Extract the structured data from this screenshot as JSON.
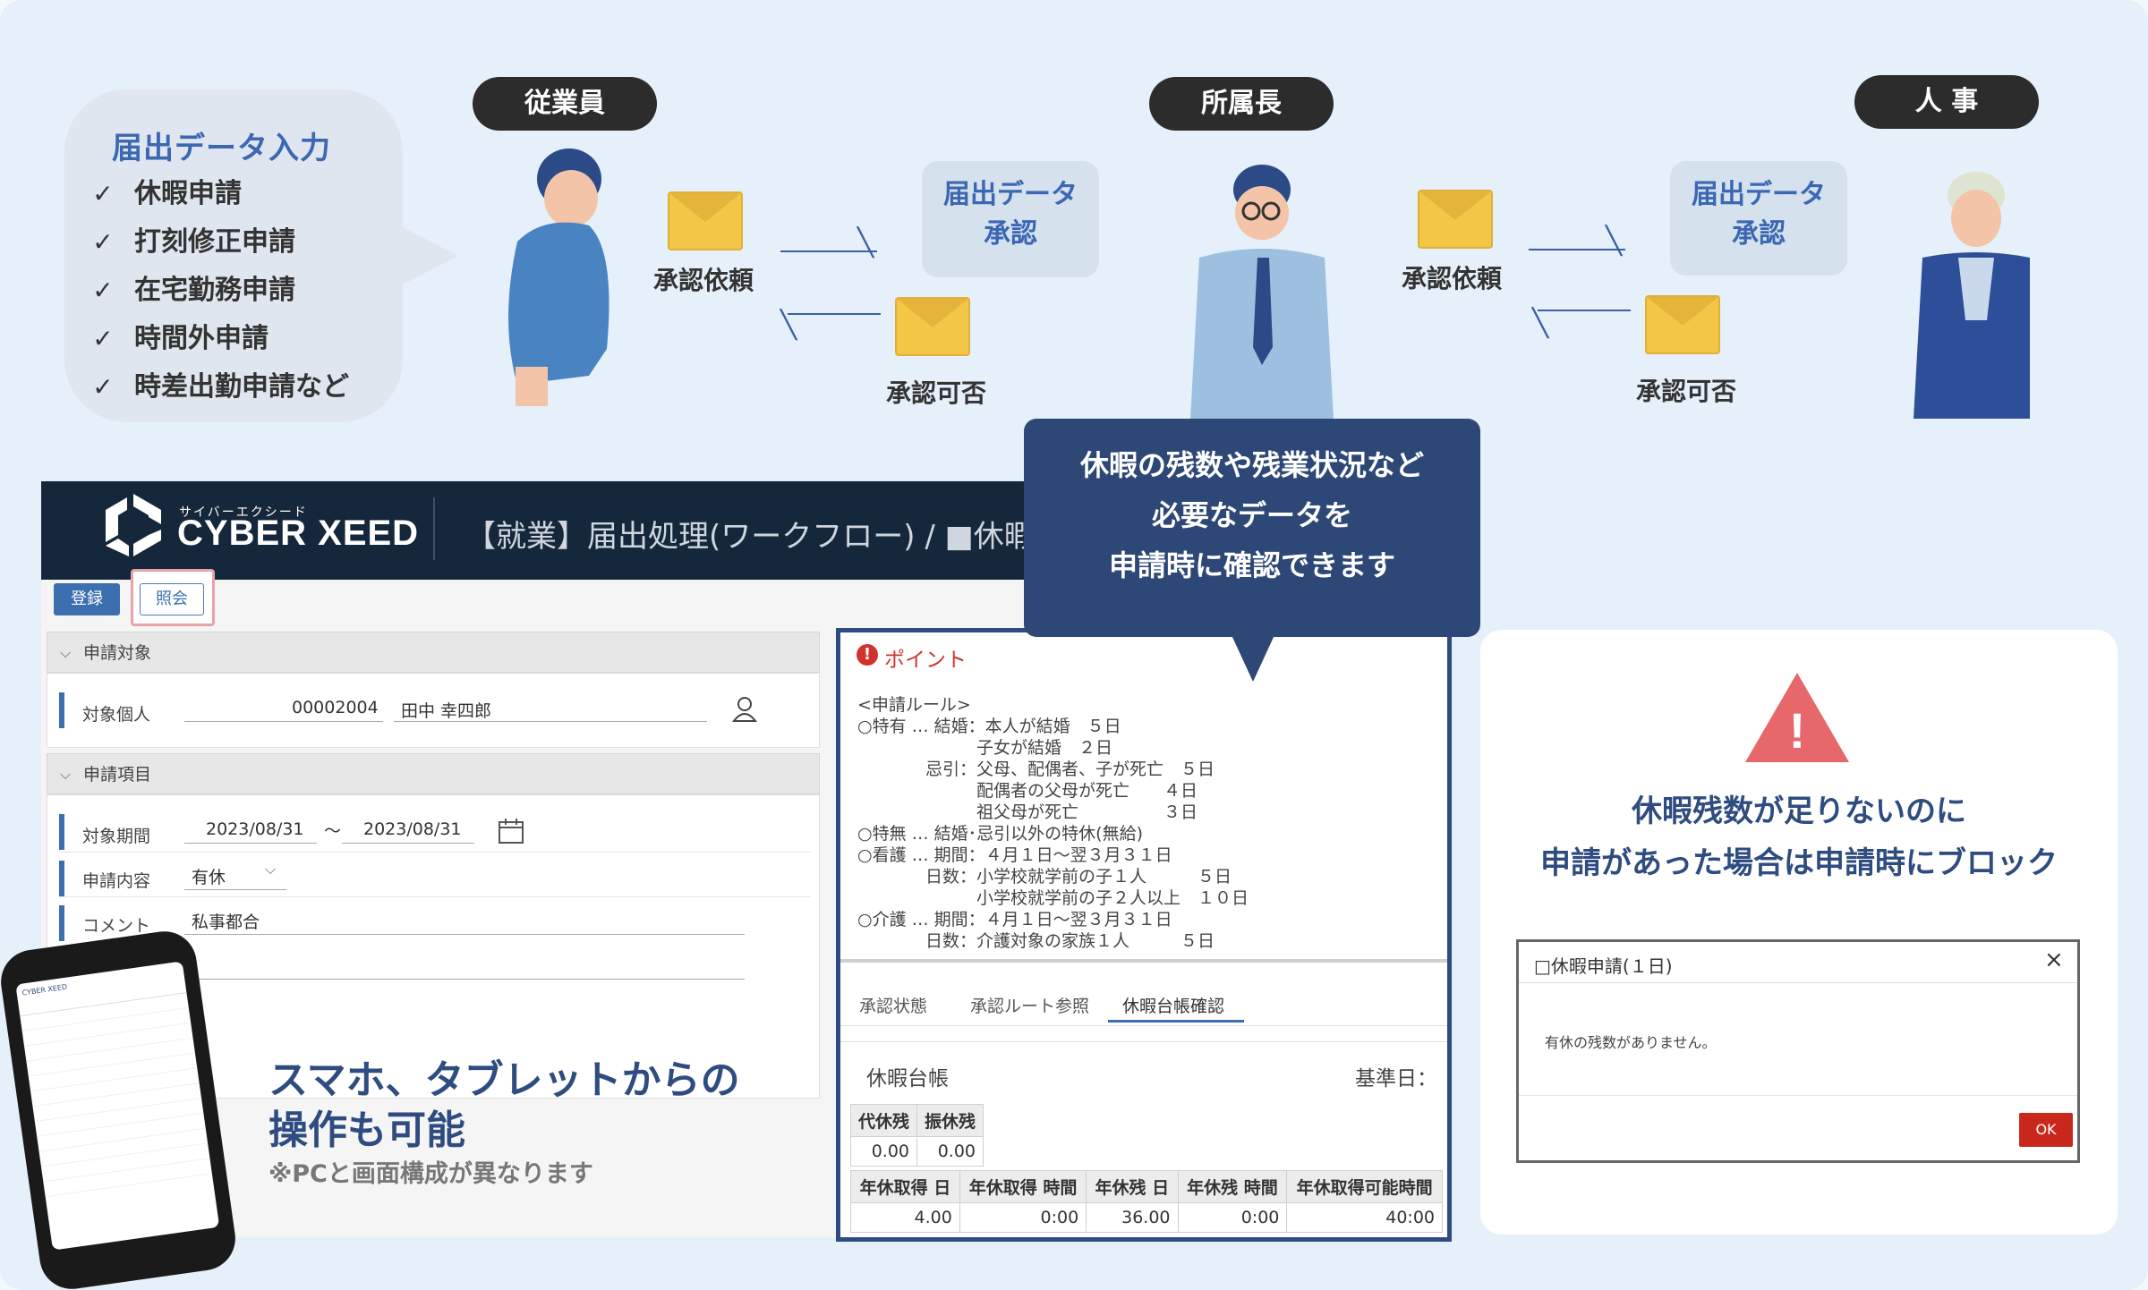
{
  "workflow": {
    "input_bubble": {
      "title": "届出データ入力",
      "items": [
        "休暇申請",
        "打刻修正申請",
        "在宅勤務申請",
        "時間外申請",
        "時差出勤申請など"
      ]
    },
    "roles": {
      "employee": "従業員",
      "manager": "所属長",
      "hr": "人 事"
    },
    "labels": {
      "request1": "承認依頼",
      "result1": "承認可否",
      "request2": "承認依頼",
      "result2": "承認可否"
    },
    "approve_cards": {
      "card1_line1": "届出データ",
      "card1_line2": "承認",
      "card2_line1": "届出データ",
      "card2_line2": "承認"
    }
  },
  "app": {
    "logo_sub": "サイバーエクシード",
    "logo": "CYBER XEED",
    "title": "【就業】届出処理(ワークフロー) / ■休暇(",
    "buttons": {
      "register": "登録",
      "reference": "照会"
    },
    "section_target": {
      "header": "申請対象",
      "label": "対象個人",
      "employee_id": "00002004",
      "employee_name": "田中 幸四郎"
    },
    "section_items": {
      "header": "申請項目",
      "period_label": "対象期間",
      "period_from": "2023/08/31",
      "period_sep": "〜",
      "period_to": "2023/08/31",
      "content_label": "申請内容",
      "content_value": "有休",
      "comment_label": "コメント",
      "comment_value": "私事都合"
    }
  },
  "point": {
    "title": "ポイント",
    "rules": [
      "<申請ルール>",
      "○特有 … 結婚：本人が結婚　５日",
      "　　　　　　　子女が結婚　２日",
      "　　　　忌引：父母、配偶者、子が死亡　５日",
      "　　　　　　　配偶者の父母が死亡　　４日",
      "　　　　　　　祖父母が死亡　　　　　３日",
      "○特無 … 結婚･忌引以外の特休(無給)",
      "○看護 … 期間：４月１日〜翌３月３１日",
      "　　　　日数：小学校就学前の子１人　　　５日",
      "　　　　　　　小学校就学前の子２人以上　１０日",
      "○介護 … 期間：４月１日〜翌３月３１日",
      "　　　　日数：介護対象の家族１人　　　５日"
    ],
    "tabs": [
      "承認状態",
      "承認ルート参照",
      "休暇台帳確認"
    ],
    "ledger_title": "休暇台帳",
    "ledger_base": "基準日：",
    "table1": {
      "headers": [
        "代休残",
        "振休残"
      ],
      "values": [
        "0.00",
        "0.00"
      ]
    },
    "table2": {
      "headers": [
        "年休取得 日",
        "年休取得 時間",
        "年休残 日",
        "年休残 時間",
        "年休取得可能時間"
      ],
      "values": [
        "4.00",
        "0:00",
        "36.00",
        "0:00",
        "40:00"
      ]
    }
  },
  "tooltip": {
    "line1": "休暇の残数や残業状況など",
    "line2": "必要なデータを",
    "line3": "申請時に確認できます"
  },
  "right": {
    "line1": "休暇残数が足りないのに",
    "line2": "申請があった場合は申請時にブロック",
    "dialog": {
      "title": "□休暇申請(１日)",
      "close": "×",
      "message": "有休の残数がありません。",
      "ok": "OK"
    }
  },
  "mobile": {
    "title_line1": "スマホ、タブレットからの",
    "title_line2": "操作も可能",
    "note": "※PCと画面構成が異なります"
  },
  "colors": {
    "accent": "#2e4c80",
    "header_dark": "#15273a",
    "envelope": "#f3c646",
    "warning": "#e6686a",
    "ok_button": "#c9271c"
  }
}
